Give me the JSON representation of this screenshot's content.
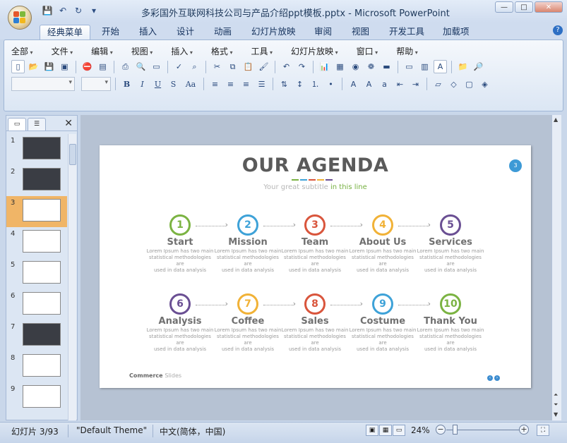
{
  "window": {
    "title": "多彩国外互联网科技公司与产品介绍ppt模板.pptx - Microsoft PowerPoint",
    "controls": [
      "—",
      "□",
      "✕"
    ]
  },
  "quick_access": {
    "icons": [
      "save-icon",
      "undo-icon",
      "redo-icon",
      "customize-icon"
    ]
  },
  "ribbon": {
    "tabs": [
      "经典菜单",
      "开始",
      "插入",
      "设计",
      "动画",
      "幻灯片放映",
      "审阅",
      "视图",
      "开发工具",
      "加载项"
    ],
    "active_tab": "经典菜单",
    "menus": [
      "全部",
      "文件",
      "编辑",
      "视图",
      "插入",
      "格式",
      "工具",
      "幻灯片放映",
      "窗口",
      "帮助"
    ],
    "font_buttons": [
      "B",
      "I",
      "U",
      "S",
      "Aa"
    ]
  },
  "panel": {
    "slides": [
      {
        "num": "1",
        "dark": true
      },
      {
        "num": "2",
        "dark": true
      },
      {
        "num": "3",
        "dark": false,
        "active": true
      },
      {
        "num": "4",
        "dark": false
      },
      {
        "num": "5",
        "dark": false
      },
      {
        "num": "6",
        "dark": false
      },
      {
        "num": "7",
        "dark": true
      },
      {
        "num": "8",
        "dark": false
      },
      {
        "num": "9",
        "dark": false
      }
    ]
  },
  "slide": {
    "title": "OUR AGENDA",
    "subtitle_gray": "Your great subtitle",
    "subtitle_green": "in this line",
    "page_number": "3",
    "footer_brand": "Commerce",
    "footer_suffix": "Slides",
    "steps": [
      {
        "num": "1",
        "label": "Start",
        "color": "#7bb342"
      },
      {
        "num": "2",
        "label": "Mission",
        "color": "#3ea2d8"
      },
      {
        "num": "3",
        "label": "Team",
        "color": "#d9553c"
      },
      {
        "num": "4",
        "label": "About Us",
        "color": "#f1b237"
      },
      {
        "num": "5",
        "label": "Services",
        "color": "#6a4f93"
      },
      {
        "num": "6",
        "label": "Analysis",
        "color": "#6a4f93"
      },
      {
        "num": "7",
        "label": "Coffee",
        "color": "#f1b237"
      },
      {
        "num": "8",
        "label": "Sales",
        "color": "#d9553c"
      },
      {
        "num": "9",
        "label": "Costume",
        "color": "#3ea2d8"
      },
      {
        "num": "10",
        "label": "Thank You",
        "color": "#7bb342"
      }
    ],
    "desc_line1": "Lorem Ipsum has two main",
    "desc_line2": "statistical methodologies are",
    "desc_line3": "used in data analysis"
  },
  "status": {
    "slide_info": "幻灯片 3/93",
    "theme": "\"Default Theme\"",
    "language": "中文(简体，中国)",
    "zoom": "24%"
  }
}
